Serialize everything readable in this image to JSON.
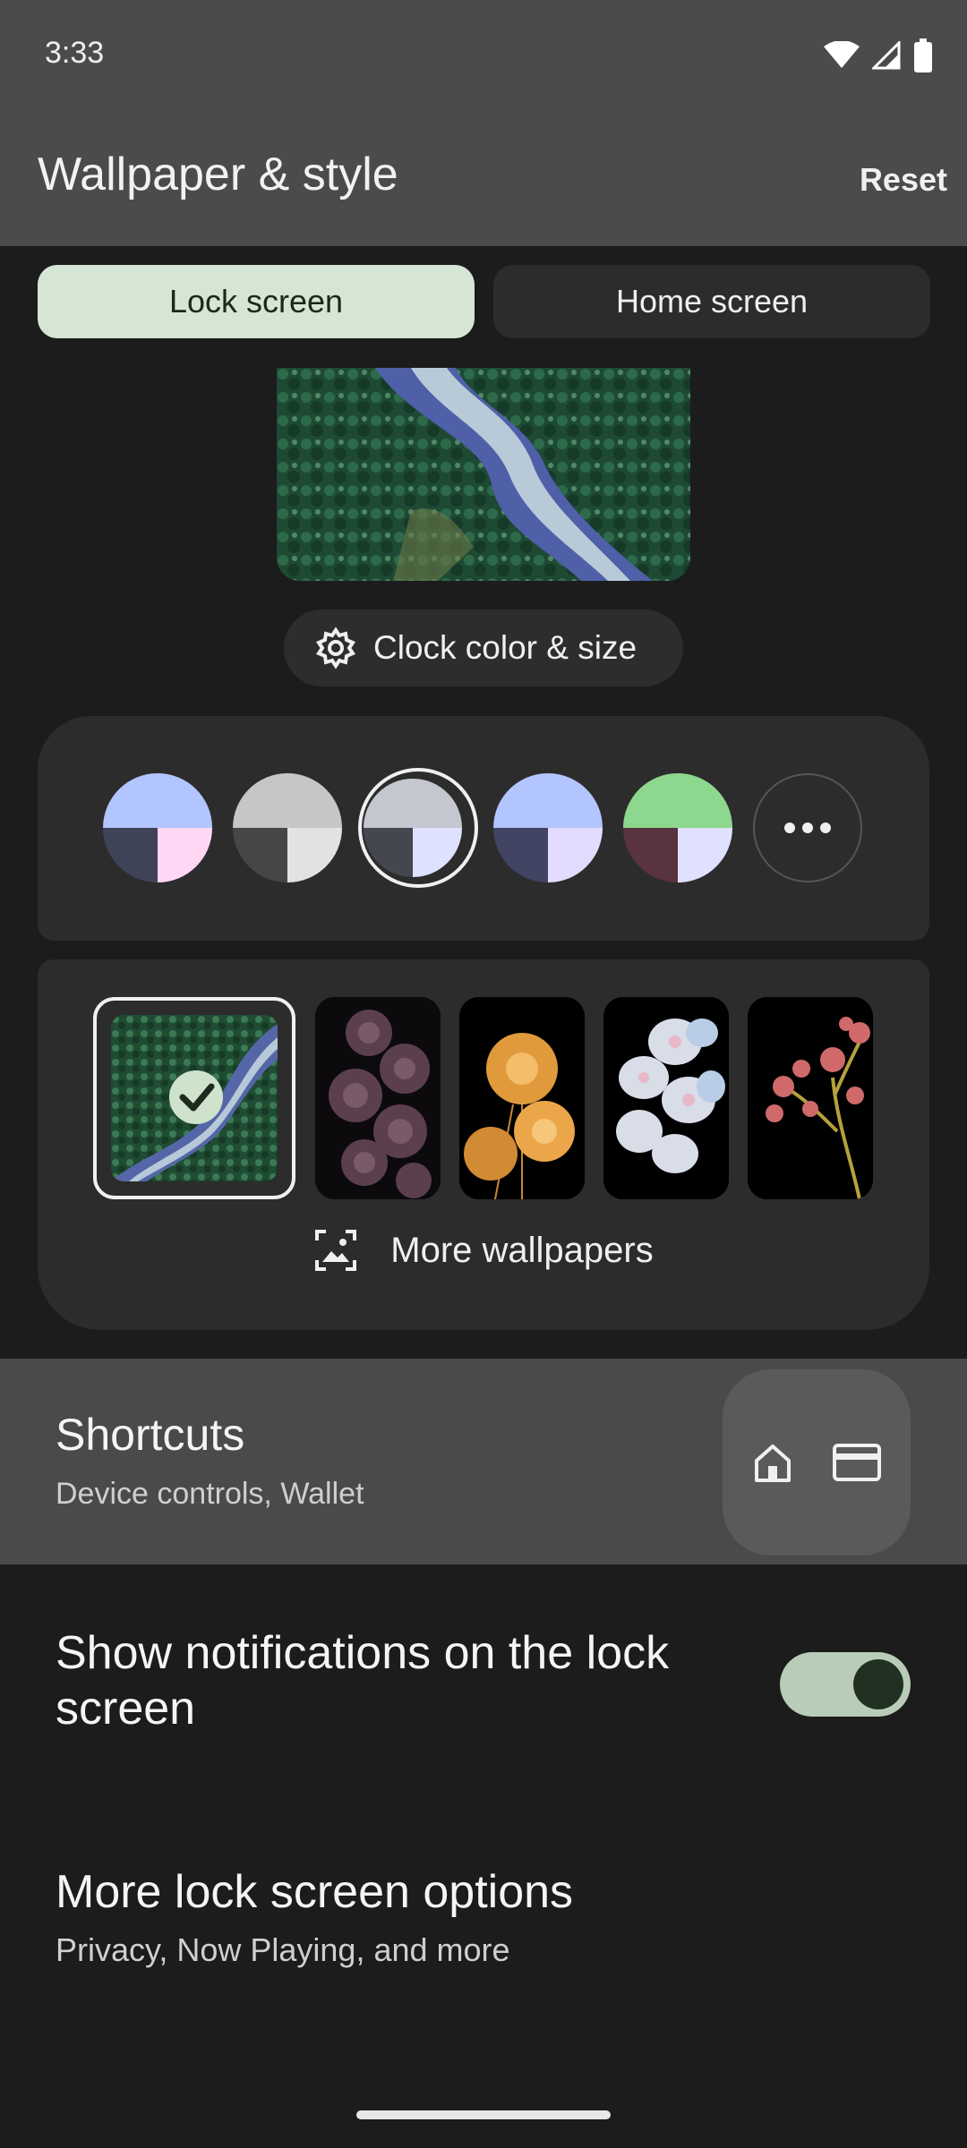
{
  "status_bar": {
    "time": "3:33",
    "icons": [
      "wifi-icon",
      "signal-icon",
      "battery-icon"
    ]
  },
  "header": {
    "title": "Wallpaper & style",
    "reset_label": "Reset"
  },
  "tabs": [
    {
      "label": "Lock screen",
      "selected": true
    },
    {
      "label": "Home screen",
      "selected": false
    }
  ],
  "clock_button": {
    "label": "Clock color & size",
    "icon": "gear-icon"
  },
  "color_options": [
    {
      "top": "#b3c5ff",
      "bl": "#3e4358",
      "br": "#ffd7f4",
      "selected": false
    },
    {
      "top": "#c6c6c6",
      "bl": "#464646",
      "br": "#e2e2e2",
      "selected": false
    },
    {
      "top": "#c4c6d0",
      "bl": "#44474f",
      "br": "#dee1ff",
      "selected": true
    },
    {
      "top": "#b3c5ff",
      "bl": "#424463",
      "br": "#e3dcff",
      "selected": false
    },
    {
      "top": "#8ed78e",
      "bl": "#5a3340",
      "br": "#e0e0ff",
      "selected": false
    }
  ],
  "more_colors_icon": "more-horizontal-icon",
  "wallpapers": {
    "more_label": "More wallpapers",
    "more_icon": "gallery-icon",
    "items": [
      "river-forest",
      "dark-succulent-flowers",
      "orange-pincushion-flowers",
      "white-orchids",
      "pink-coral-plant"
    ]
  },
  "shortcuts": {
    "title": "Shortcuts",
    "subtitle": "Device controls, Wallet",
    "icons": [
      "home-icon",
      "wallet-card-icon"
    ]
  },
  "notifications": {
    "label": "Show notifications on the lock screen",
    "enabled": true
  },
  "more_options": {
    "title": "More lock screen options",
    "subtitle": "Privacy, Now Playing, and more"
  }
}
